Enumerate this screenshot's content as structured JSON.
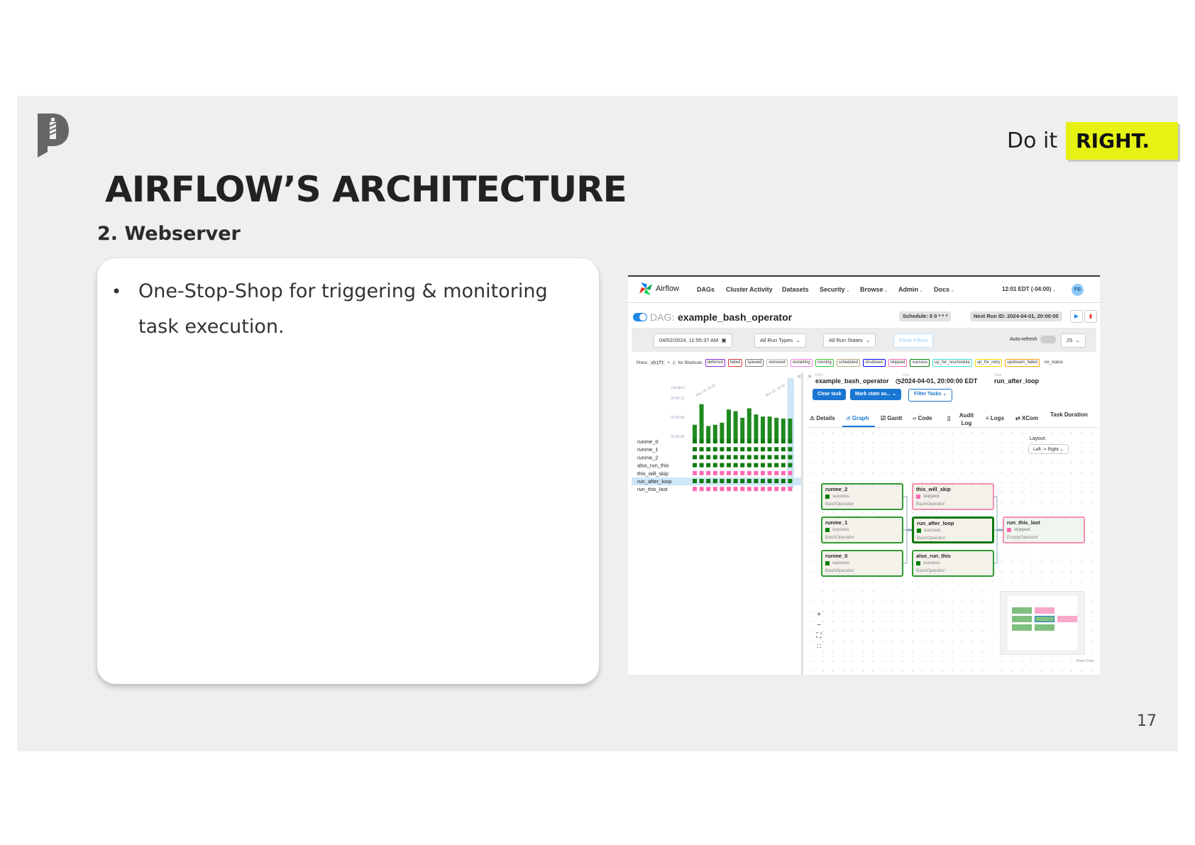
{
  "slide": {
    "tagline_pre": "Do it",
    "tagline_highlight": "RIGHT.",
    "title": "AIRFLOW’S ARCHITECTURE",
    "subtitle": "2. Webserver",
    "bullet": "One-Stop-Shop for triggering & monitoring task execution.",
    "page_number": "17",
    "colors": {
      "background": "#efefef",
      "highlight": "#e5f213",
      "logo": "#666666"
    }
  },
  "airflow": {
    "brand": "Airflow",
    "nav": [
      "DAGs",
      "Cluster Activity",
      "Datasets",
      "Security",
      "Browse",
      "Admin",
      "Docs"
    ],
    "nav_dropdown": [
      "Security",
      "Browse",
      "Admin",
      "Docs"
    ],
    "clock": "12:01 EDT (-04:00)",
    "user_initials": "FB",
    "dag_label": "DAG:",
    "dag_name": "example_bash_operator",
    "schedule": "Schedule: 0 0 * * *",
    "next_run": "Next Run ID: 2024-04-01, 20:00:00",
    "filters": {
      "date": "04/02/2024, 11:55:37 AM",
      "run_types": "All Run Types",
      "run_states": "All Run States",
      "clear_filters": "Clear Filters",
      "auto_refresh": "Auto-refresh",
      "page_size": "25"
    },
    "shortcut_hint": {
      "press": "Press",
      "key": "shift",
      "plus": "+",
      "slash": "/",
      "rest": "for Shortcuts"
    },
    "states": [
      {
        "label": "deferred",
        "color": "#8a2be2"
      },
      {
        "label": "failed",
        "color": "#e53935"
      },
      {
        "label": "queued",
        "color": "#808080"
      },
      {
        "label": "removed",
        "color": "#c0c0c0"
      },
      {
        "label": "restarting",
        "color": "#ee82ee"
      },
      {
        "label": "running",
        "color": "#32cd32"
      },
      {
        "label": "scheduled",
        "color": "#b4a77a"
      },
      {
        "label": "shutdown",
        "color": "#0000ff"
      },
      {
        "label": "skipped",
        "color": "#ff69b4"
      },
      {
        "label": "success",
        "color": "#008000"
      },
      {
        "label": "up_for_reschedule",
        "color": "#40e0d0"
      },
      {
        "label": "up_for_retry",
        "color": "#ffd700"
      },
      {
        "label": "upstream_failed",
        "color": "#ffa500"
      },
      {
        "label": "no_status",
        "color": "#ffffff"
      }
    ],
    "grid": {
      "duration_label": "Duration",
      "ticks": [
        "00:00:12",
        "00:00:06",
        "00:00:00"
      ],
      "date_labels": [
        "Mar 19, 19:26",
        "Mar 20, 20:00"
      ],
      "durations": [
        0.35,
        0.85,
        0.32,
        0.35,
        0.4,
        0.72,
        0.68,
        0.52,
        0.75,
        0.6,
        0.55,
        0.55,
        0.52,
        0.5,
        0.5
      ],
      "tasks": [
        {
          "name": "runme_0",
          "state": "success"
        },
        {
          "name": "runme_1",
          "state": "success"
        },
        {
          "name": "runme_2",
          "state": "success"
        },
        {
          "name": "also_run_this",
          "state": "success"
        },
        {
          "name": "this_will_skip",
          "state": "skipped"
        },
        {
          "name": "run_after_loop",
          "state": "success",
          "selected": true
        },
        {
          "name": "run_this_last",
          "state": "skipped"
        }
      ],
      "runs": 15
    },
    "detail": {
      "bc_dag_label": "DAG",
      "bc_run_label": "Run",
      "bc_task_label": "Task",
      "bc_dag": "example_bash_operator",
      "bc_run": "2024-04-01, 20:00:00 EDT",
      "bc_task": "run_after_loop",
      "buttons": {
        "clear": "Clear task",
        "mark": "Mark state as...",
        "filter": "Filter Tasks"
      },
      "tabs": [
        "Details",
        "Graph",
        "Gantt",
        "Code",
        "Audit Log",
        "Logs",
        "XCom",
        "Task Duration"
      ],
      "layout_label": "Layout:",
      "layout_value": "Left -> Right",
      "react_flow": "React Flow"
    },
    "nodes": [
      {
        "name": "runme_2",
        "state": "success",
        "operator": "BashOperator"
      },
      {
        "name": "runme_1",
        "state": "success",
        "operator": "BashOperator"
      },
      {
        "name": "runme_0",
        "state": "success",
        "operator": "BashOperator"
      },
      {
        "name": "this_will_skip",
        "state": "skipped",
        "operator": "BashOperator"
      },
      {
        "name": "run_after_loop",
        "state": "success",
        "operator": "BashOperator"
      },
      {
        "name": "also_run_this",
        "state": "success",
        "operator": "BashOperator"
      },
      {
        "name": "run_this_last",
        "state": "skipped",
        "operator": "EmptyOperator"
      }
    ]
  }
}
